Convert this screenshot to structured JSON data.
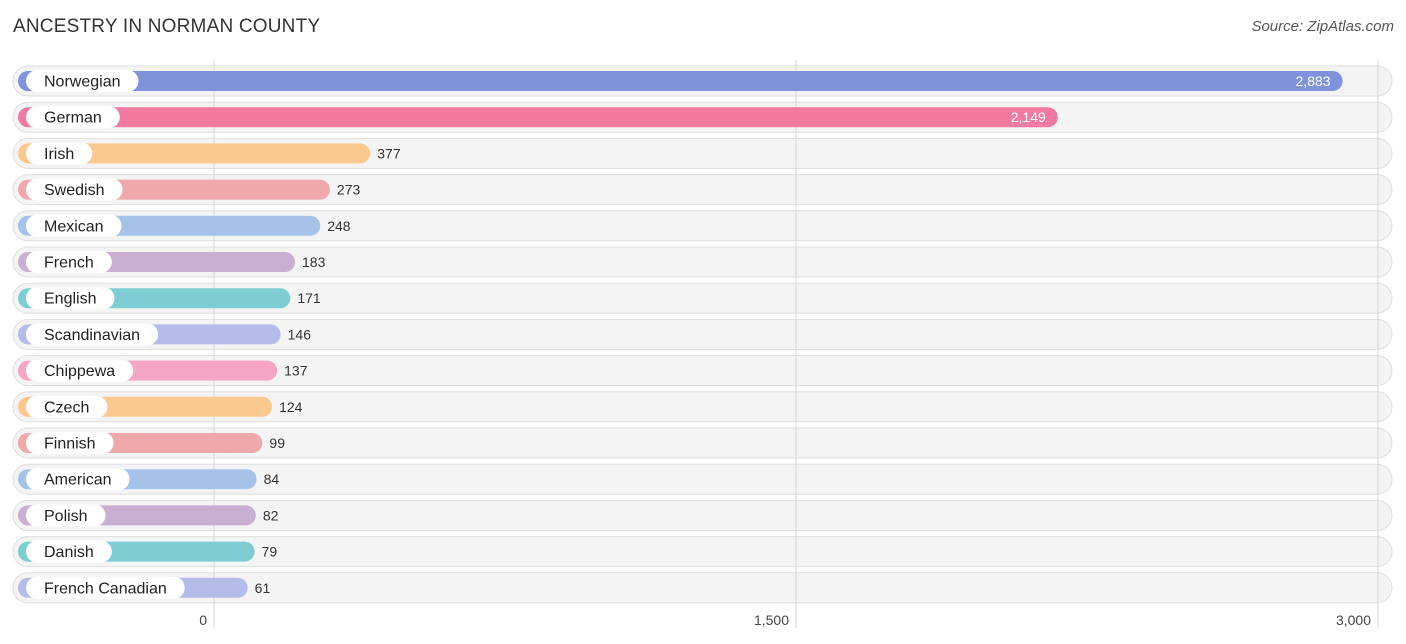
{
  "header": {
    "title": "ANCESTRY IN NORMAN COUNTY",
    "source": "Source: ZipAtlas.com"
  },
  "chart_data": {
    "type": "bar",
    "orientation": "horizontal",
    "title": "ANCESTRY IN NORMAN COUNTY",
    "xlabel": "",
    "ylabel": "",
    "xlim": [
      0,
      3000
    ],
    "x_ticks": [
      0,
      1500,
      3000
    ],
    "x_tick_labels": [
      "0",
      "1,500",
      "3,000"
    ],
    "grid": true,
    "categories": [
      "Norwegian",
      "German",
      "Irish",
      "Swedish",
      "Mexican",
      "French",
      "English",
      "Scandinavian",
      "Chippewa",
      "Czech",
      "Finnish",
      "American",
      "Polish",
      "Danish",
      "French Canadian"
    ],
    "values": [
      2883,
      2149,
      377,
      273,
      248,
      183,
      171,
      146,
      137,
      124,
      99,
      84,
      82,
      79,
      61
    ],
    "value_labels": [
      "2,883",
      "2,149",
      "377",
      "273",
      "248",
      "183",
      "171",
      "146",
      "137",
      "124",
      "99",
      "84",
      "82",
      "79",
      "61"
    ],
    "colors": [
      "#7f93dd",
      "#f27aa0",
      "#fbc990",
      "#f0a9aa",
      "#a5c3e8",
      "#c9b0d3",
      "#7dcdd2",
      "#b4bde9",
      "#f6a6c4",
      "#fbc990",
      "#f0a9aa",
      "#a5c3e8",
      "#c9b0d3",
      "#7dcdd2",
      "#b4bde9"
    ]
  }
}
